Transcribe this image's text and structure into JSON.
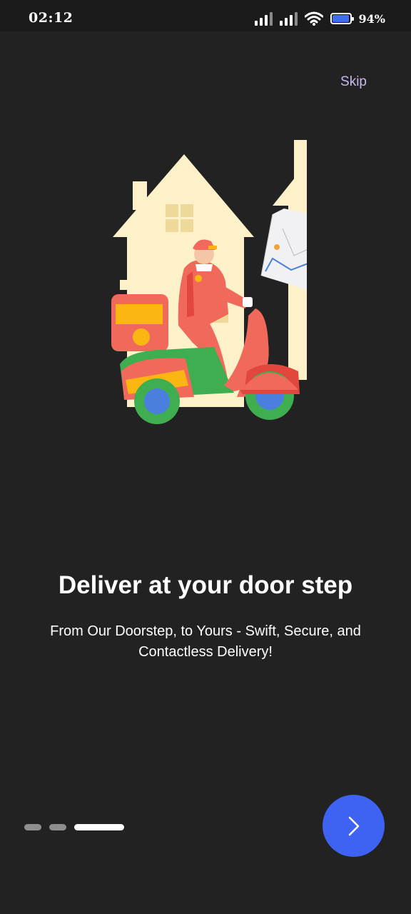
{
  "status_bar": {
    "time": "02:12",
    "battery_percent": 94,
    "battery_text": "94%",
    "icons": [
      "signal-icon",
      "signal-icon",
      "wifi-icon",
      "battery-icon"
    ]
  },
  "skip_label": "Skip",
  "illustration": {
    "icon": "delivery-scooter-illustration"
  },
  "onboarding": {
    "title": "Deliver at your door step",
    "subtitle": "From Our Doorstep, to Yours - Swift, Secure, and Contactless Delivery!"
  },
  "pager": {
    "total": 3,
    "current": 3
  },
  "next_button": {
    "icon": "chevron-right-icon"
  },
  "colors": {
    "background": "#222222",
    "accent": "#3e63f2",
    "skip": "#c9b8f0",
    "house": "#fdf1c9",
    "scooter": "#f0695a",
    "accent_yellow": "#fbb611",
    "accent_green": "#3fae50"
  }
}
